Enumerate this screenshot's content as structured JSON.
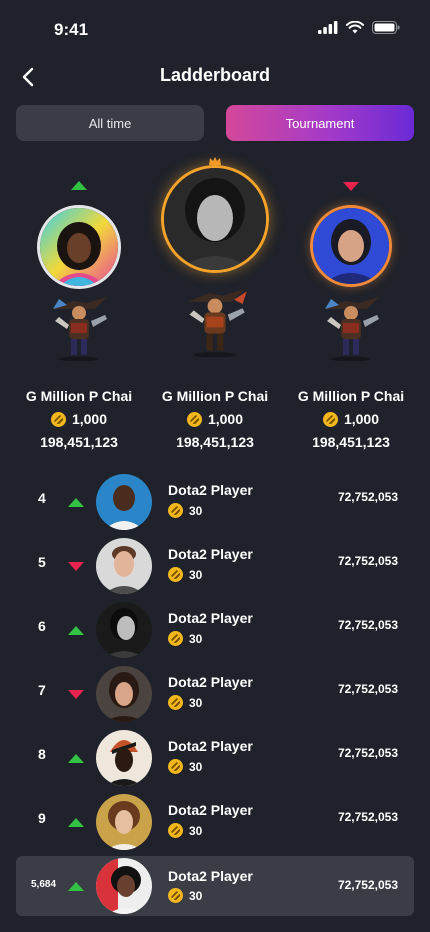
{
  "status_bar": {
    "time": "9:41"
  },
  "header": {
    "title": "Ladderboard"
  },
  "tabs": [
    {
      "label": "All time"
    },
    {
      "label": "Tournament"
    }
  ],
  "podium": [
    {
      "name": "G Million P Chai",
      "coins": "1,000",
      "score": "198,451,123",
      "trend": "up"
    },
    {
      "name": "G Million P Chai",
      "coins": "1,000",
      "score": "198,451,123",
      "trend": "crown"
    },
    {
      "name": "G Million P Chai",
      "coins": "1,000",
      "score": "198,451,123",
      "trend": "down"
    }
  ],
  "list": [
    {
      "rank": "4",
      "trend": "up",
      "name": "Dota2 Player",
      "points": "30",
      "score": "72,752,053"
    },
    {
      "rank": "5",
      "trend": "down",
      "name": "Dota2 Player",
      "points": "30",
      "score": "72,752,053"
    },
    {
      "rank": "6",
      "trend": "up",
      "name": "Dota2 Player",
      "points": "30",
      "score": "72,752,053"
    },
    {
      "rank": "7",
      "trend": "down",
      "name": "Dota2 Player",
      "points": "30",
      "score": "72,752,053"
    },
    {
      "rank": "8",
      "trend": "up",
      "name": "Dota2 Player",
      "points": "30",
      "score": "72,752,053"
    },
    {
      "rank": "9",
      "trend": "up",
      "name": "Dota2 Player",
      "points": "30",
      "score": "72,752,053"
    }
  ],
  "current_user": {
    "rank": "5,684",
    "trend": "up",
    "name": "Dota2 Player",
    "points": "30",
    "score": "72,752,053"
  },
  "colors": {
    "background": "#1f222a",
    "up": "#34c244",
    "down": "#e8234d",
    "gold": "#f3b81d",
    "highlight": "#3a3d46"
  }
}
